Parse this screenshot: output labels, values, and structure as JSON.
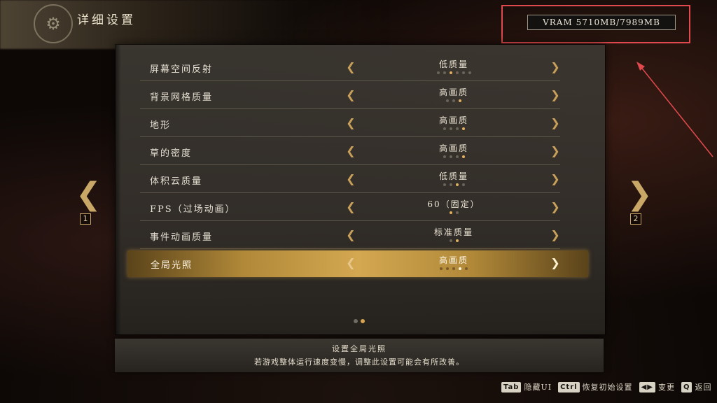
{
  "header": {
    "title": "详细设置",
    "emblem_icon": "gear-icon"
  },
  "vram": {
    "text": "VRAM 5710MB/7989MB"
  },
  "settings": [
    {
      "label": "屏幕空间反射",
      "value": "低质量",
      "dots": 6,
      "active_dot": 3,
      "selected": false
    },
    {
      "label": "背景网格质量",
      "value": "高画质",
      "dots": 3,
      "active_dot": 3,
      "selected": false
    },
    {
      "label": "地形",
      "value": "高画质",
      "dots": 4,
      "active_dot": 4,
      "selected": false
    },
    {
      "label": "草的密度",
      "value": "高画质",
      "dots": 4,
      "active_dot": 4,
      "selected": false
    },
    {
      "label": "体积云质量",
      "value": "低质量",
      "dots": 4,
      "active_dot": 3,
      "selected": false
    },
    {
      "label": "FPS（过场动画）",
      "value": "60（固定）",
      "dots": 2,
      "active_dot": 1,
      "selected": false
    },
    {
      "label": "事件动画质量",
      "value": "标准质量",
      "dots": 2,
      "active_dot": 2,
      "selected": false
    },
    {
      "label": "全局光照",
      "value": "高画质",
      "dots": 5,
      "active_dot": 4,
      "selected": true
    }
  ],
  "pager": {
    "pages": 2,
    "current": 2,
    "prev_label": "1",
    "next_label": "2"
  },
  "description": {
    "title": "设置全局光照",
    "text": "若游戏整体运行速度变慢，调整此设置可能会有所改善。"
  },
  "hints": [
    {
      "key": "Tab",
      "label": "隐藏UI"
    },
    {
      "key": "Ctrl",
      "label": "恢复初始设置"
    },
    {
      "key": "◀▶",
      "label": "变更"
    },
    {
      "key": "Q",
      "label": "返回"
    }
  ],
  "colors": {
    "accent_gold": "#d4a851",
    "annotation_red": "#e0494d"
  }
}
